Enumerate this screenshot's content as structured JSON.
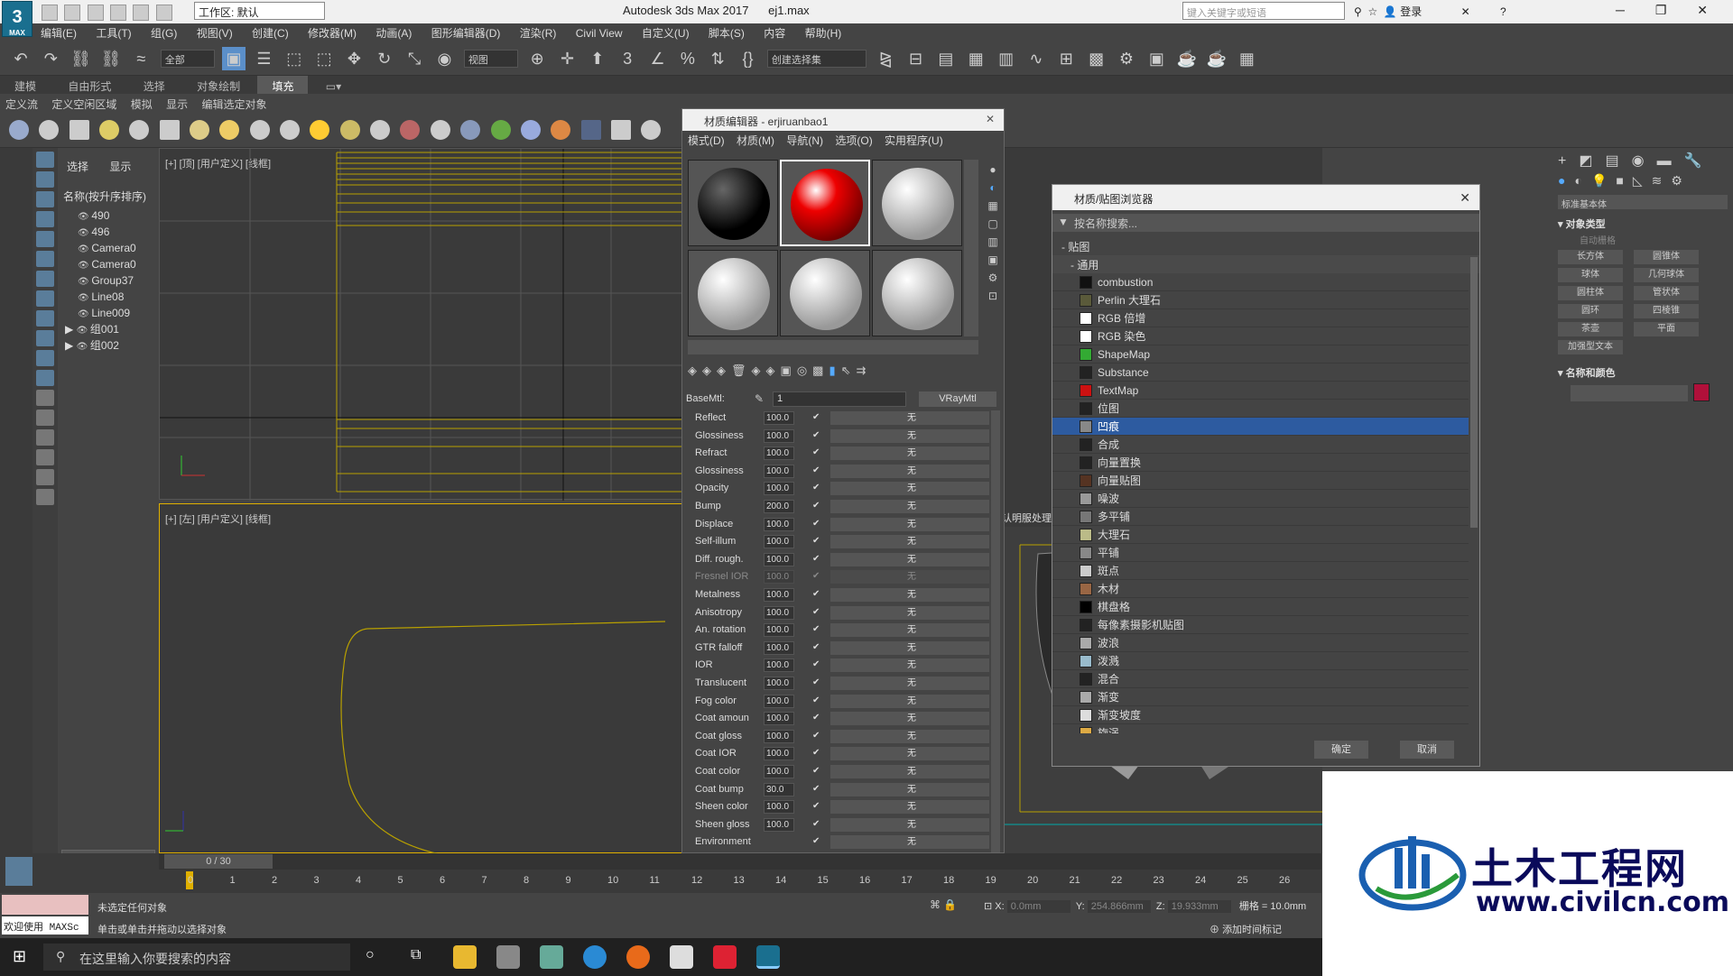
{
  "app": {
    "title": "Autodesk 3ds Max 2017",
    "file": "ej1.max",
    "workspace": "工作区: 默认",
    "search_placeholder": "键入关键字或短语",
    "login": "登录",
    "logo": "3",
    "logo_sub": "MAX"
  },
  "menu": [
    "编辑(E)",
    "工具(T)",
    "组(G)",
    "视图(V)",
    "创建(C)",
    "修改器(M)",
    "动画(A)",
    "图形编辑器(D)",
    "渲染(R)",
    "Civil View",
    "自定义(U)",
    "脚本(S)",
    "内容",
    "帮助(H)"
  ],
  "toolbar": {
    "filter": "全部",
    "view": "视图",
    "selset": "创建选择集"
  },
  "ribbon_tabs": [
    "建模",
    "自由形式",
    "选择",
    "对象绘制",
    "填充"
  ],
  "ribbon_active": 4,
  "ribbon_sub": [
    "定义流",
    "定义空闲区域",
    "模拟",
    "显示",
    "编辑选定对象"
  ],
  "scene": {
    "tabs": [
      "选择",
      "显示"
    ],
    "header": "名称(按升序排序)",
    "items": [
      "490",
      "496",
      "Camera0",
      "Camera0",
      "Group37",
      "Line08",
      "Line009",
      "组001",
      "组002"
    ]
  },
  "viewports": {
    "top": "[+] [顶] [用户定义] [线框]",
    "left": "[+] [左] [用户定义] [线框]",
    "persp_note": "认明服处理"
  },
  "timeline": {
    "frame": "0 / 30",
    "ticks": [
      "0",
      "1",
      "2",
      "3",
      "4",
      "5",
      "6",
      "7",
      "8",
      "9",
      "10",
      "11",
      "12",
      "13",
      "14",
      "15",
      "16",
      "17",
      "18",
      "19",
      "20",
      "21",
      "22",
      "23",
      "24",
      "25",
      "26"
    ]
  },
  "status": {
    "line1": "未选定任何对象",
    "line2": "单击或单击并拖动以选择对象",
    "welcome": "欢迎使用 MAXSc",
    "x_label": "X:",
    "x": "0.0mm",
    "y_label": "Y:",
    "y": "254.866mm",
    "z_label": "Z:",
    "z": "19.933mm",
    "grid": "栅格 = 10.0mm",
    "addtime": "添加时间标记"
  },
  "mat_editor": {
    "title": "材质编辑器 - erjiruanbao1",
    "menu": [
      "模式(D)",
      "材质(M)",
      "导航(N)",
      "选项(O)",
      "实用程序(U)"
    ],
    "basemtl_label": "BaseMtl:",
    "basemtl_value": "1",
    "type": "VRayMtl",
    "none": "无",
    "params": [
      {
        "name": "Reflect",
        "value": "100.0"
      },
      {
        "name": "Glossiness",
        "value": "100.0"
      },
      {
        "name": "Refract",
        "value": "100.0"
      },
      {
        "name": "Glossiness",
        "value": "100.0"
      },
      {
        "name": "Opacity",
        "value": "100.0"
      },
      {
        "name": "Bump",
        "value": "200.0"
      },
      {
        "name": "Displace",
        "value": "100.0"
      },
      {
        "name": "Self-illum",
        "value": "100.0"
      },
      {
        "name": "Diff. rough.",
        "value": "100.0"
      },
      {
        "name": "Fresnel IOR",
        "value": "100.0"
      },
      {
        "name": "Metalness",
        "value": "100.0"
      },
      {
        "name": "Anisotropy",
        "value": "100.0"
      },
      {
        "name": "An. rotation",
        "value": "100.0"
      },
      {
        "name": "GTR falloff",
        "value": "100.0"
      },
      {
        "name": "IOR",
        "value": "100.0"
      },
      {
        "name": "Translucent",
        "value": "100.0"
      },
      {
        "name": "Fog color",
        "value": "100.0"
      },
      {
        "name": "Coat amoun",
        "value": "100.0"
      },
      {
        "name": "Coat gloss",
        "value": "100.0"
      },
      {
        "name": "Coat IOR",
        "value": "100.0"
      },
      {
        "name": "Coat color",
        "value": "100.0"
      },
      {
        "name": "Coat bump",
        "value": "30.0"
      },
      {
        "name": "Sheen color",
        "value": "100.0"
      },
      {
        "name": "Sheen gloss",
        "value": "100.0"
      },
      {
        "name": "Environment",
        "value": ""
      }
    ]
  },
  "browser": {
    "title": "材质/贴图浏览器",
    "search": "按名称搜索...",
    "group": "贴图",
    "subgroup": "通用",
    "items": [
      "combustion",
      "Perlin 大理石",
      "RGB 倍增",
      "RGB 染色",
      "ShapeMap",
      "Substance",
      "TextMap",
      "位图",
      "凹痕",
      "合成",
      "向量置换",
      "向量贴图",
      "噪波",
      "多平铺",
      "大理石",
      "平铺",
      "斑点",
      "木材",
      "棋盘格",
      "每像素摄影机贴图",
      "波浪",
      "泼溅",
      "混合",
      "渐变",
      "渐变坡度",
      "旋涡"
    ],
    "selected": 8,
    "ok": "确定",
    "cancel": "取消"
  },
  "cmd": {
    "dropdown": "标准基本体",
    "section1": "对象类型",
    "autogrid": "自动栅格",
    "buttons": [
      "长方体",
      "圆锥体",
      "球体",
      "几何球体",
      "圆柱体",
      "管状体",
      "圆环",
      "四棱锥",
      "茶壶",
      "平面",
      "加强型文本"
    ],
    "section2": "名称和颜色",
    "swatch_color": "#b0103a"
  },
  "taskbar": {
    "search": "在这里输入你要搜索的内容"
  },
  "watermark": {
    "title": "土木工程网",
    "url": "www.civilcn.com"
  }
}
